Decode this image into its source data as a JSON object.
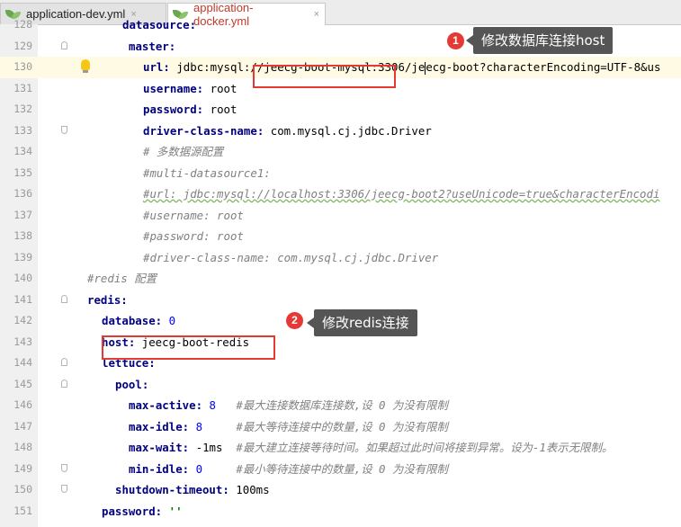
{
  "tabs": [
    {
      "label": "application-dev.yml",
      "close": "×",
      "active": false
    },
    {
      "label": "application-docker.yml",
      "close": "×",
      "active": true
    }
  ],
  "editor": {
    "lines": [
      {
        "num": "128",
        "segments": [
          {
            "t": "datasource:",
            "c": "k"
          }
        ]
      },
      {
        "num": "129",
        "segments": [
          {
            "t": "master:",
            "c": "k"
          }
        ]
      },
      {
        "num": "130",
        "segments": [
          {
            "t": "url: ",
            "c": "k"
          },
          {
            "t": "jdbc:mysql:",
            "c": "v"
          },
          {
            "t": "//jeecg-boot-mysql:",
            "c": "v"
          },
          {
            "t": "3306/je",
            "c": "v"
          },
          {
            "t": "ecg-boot?characterEncoding=UTF-8&us",
            "c": "v"
          }
        ]
      },
      {
        "num": "131",
        "segments": [
          {
            "t": "username: ",
            "c": "k"
          },
          {
            "t": "root",
            "c": "v"
          }
        ]
      },
      {
        "num": "132",
        "segments": [
          {
            "t": "password: ",
            "c": "k"
          },
          {
            "t": "root",
            "c": "v"
          }
        ]
      },
      {
        "num": "133",
        "segments": [
          {
            "t": "driver-class-name: ",
            "c": "k"
          },
          {
            "t": "com.mysql.cj.jdbc.Driver",
            "c": "v"
          }
        ]
      },
      {
        "num": "134",
        "segments": [
          {
            "t": "# 多数据源配置",
            "c": "c"
          }
        ]
      },
      {
        "num": "135",
        "segments": [
          {
            "t": "#multi-datasource1:",
            "c": "c"
          }
        ]
      },
      {
        "num": "136",
        "segments": [
          {
            "t": "#url: jdbc:mysql://localhost:3306/jeecg-boot2?useUnicode=true&characterEncodi",
            "c": "c"
          }
        ]
      },
      {
        "num": "137",
        "segments": [
          {
            "t": "#username: root",
            "c": "c"
          }
        ]
      },
      {
        "num": "138",
        "segments": [
          {
            "t": "#password: root",
            "c": "c"
          }
        ]
      },
      {
        "num": "139",
        "segments": [
          {
            "t": "#driver-class-name: com.mysql.cj.jdbc.Driver",
            "c": "c"
          }
        ]
      },
      {
        "num": "140",
        "segments": [
          {
            "t": "#redis 配置",
            "c": "c"
          }
        ]
      },
      {
        "num": "141",
        "segments": [
          {
            "t": "redis:",
            "c": "k"
          }
        ]
      },
      {
        "num": "142",
        "segments": [
          {
            "t": "database: ",
            "c": "k"
          },
          {
            "t": "0",
            "c": "n"
          }
        ]
      },
      {
        "num": "143",
        "segments": [
          {
            "t": "host",
            "c": "k"
          },
          {
            "t": ": ",
            "c": "k"
          },
          {
            "t": "jeecg-boot-redis",
            "c": "v"
          }
        ]
      },
      {
        "num": "144",
        "segments": [
          {
            "t": "lettuce:",
            "c": "k"
          }
        ]
      },
      {
        "num": "145",
        "segments": [
          {
            "t": "pool:",
            "c": "k"
          }
        ]
      },
      {
        "num": "146",
        "segments": [
          {
            "t": "max-active: ",
            "c": "k"
          },
          {
            "t": "8",
            "c": "n"
          },
          {
            "t": "   #最大连接数据库连接数,设 0 为没有限制",
            "c": "c"
          }
        ]
      },
      {
        "num": "147",
        "segments": [
          {
            "t": "max-idle: ",
            "c": "k"
          },
          {
            "t": "8",
            "c": "n"
          },
          {
            "t": "     #最大等待连接中的数量,设 0 为没有限制",
            "c": "c"
          }
        ]
      },
      {
        "num": "148",
        "segments": [
          {
            "t": "max-wait: ",
            "c": "k"
          },
          {
            "t": "-1ms",
            "c": "v"
          },
          {
            "t": "  #最大建立连接等待时间。如果超过此时间将接到异常。设为-1表示无限制。",
            "c": "c"
          }
        ]
      },
      {
        "num": "149",
        "segments": [
          {
            "t": "min-idle: ",
            "c": "k"
          },
          {
            "t": "0",
            "c": "n"
          },
          {
            "t": "     #最小等待连接中的数量,设 0 为没有限制",
            "c": "c"
          }
        ]
      },
      {
        "num": "150",
        "segments": [
          {
            "t": "shutdown-timeout: ",
            "c": "k"
          },
          {
            "t": "100ms",
            "c": "v"
          }
        ]
      },
      {
        "num": "151",
        "segments": [
          {
            "t": "password: ",
            "c": "k"
          },
          {
            "t": "''",
            "c": "s"
          }
        ]
      }
    ]
  },
  "annotations": {
    "one": {
      "badge": "1",
      "text": "修改数据库连接host"
    },
    "two": {
      "badge": "2",
      "text": "修改redis连接"
    }
  }
}
